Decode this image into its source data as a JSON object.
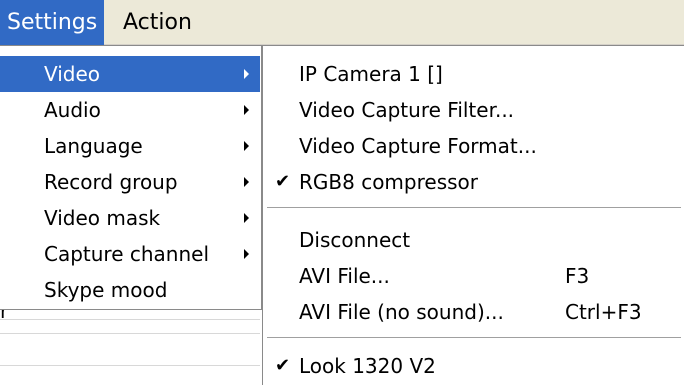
{
  "menubar": {
    "items": [
      "Settings",
      "Action"
    ]
  },
  "background": {
    "fragment": "r"
  },
  "settings_menu": {
    "items": [
      {
        "label": "Video",
        "submenu": true,
        "highlighted": true
      },
      {
        "label": "Audio",
        "submenu": true
      },
      {
        "label": "Language",
        "submenu": true
      },
      {
        "label": "Record group",
        "submenu": true
      },
      {
        "label": "Video mask",
        "submenu": true
      },
      {
        "label": "Capture channel",
        "submenu": true
      },
      {
        "label": "Skype mood",
        "submenu": false
      }
    ]
  },
  "video_submenu": {
    "items": [
      {
        "label": "IP Camera 1 []",
        "checked": false,
        "shortcut": ""
      },
      {
        "label": "Video Capture Filter...",
        "checked": false,
        "shortcut": ""
      },
      {
        "label": "Video Capture Format...",
        "checked": false,
        "shortcut": ""
      },
      {
        "label": "RGB8 compressor",
        "checked": true,
        "shortcut": ""
      },
      {
        "label": "Disconnect",
        "checked": false,
        "shortcut": ""
      },
      {
        "label": "AVI File...",
        "checked": false,
        "shortcut": "F3"
      },
      {
        "label": "AVI File (no sound)...",
        "checked": false,
        "shortcut": "Ctrl+F3"
      },
      {
        "label": "Look 1320 V2",
        "checked": true,
        "shortcut": ""
      }
    ],
    "check_glyph": "✔"
  },
  "colors": {
    "highlight": "#316ac5",
    "menubar": "#ece9d8"
  }
}
